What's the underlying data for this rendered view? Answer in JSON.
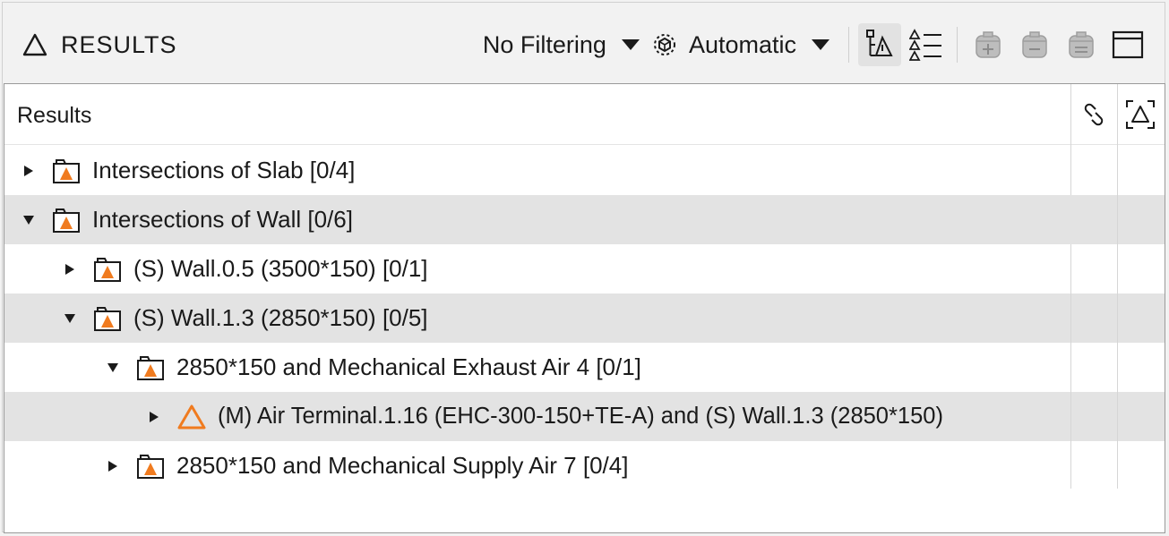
{
  "header": {
    "title": "RESULTS",
    "filter_label": "No Filtering",
    "mode_label": "Automatic"
  },
  "colors": {
    "accent_orange": "#f07b1f",
    "row_shade": "#e3e3e3"
  },
  "tree": {
    "column_title": "Results",
    "rows": [
      {
        "label": "Intersections of Slab [0/4]",
        "expanded": false
      },
      {
        "label": "Intersections of Wall [0/6]",
        "expanded": true
      },
      {
        "label": "(S) Wall.0.5 (3500*150) [0/1]",
        "expanded": false
      },
      {
        "label": "(S) Wall.1.3 (2850*150) [0/5]",
        "expanded": true
      },
      {
        "label": "2850*150 and Mechanical Exhaust Air 4 [0/1]",
        "expanded": true
      },
      {
        "label": "(M) Air Terminal.1.16 (EHC-300-150+TE-A) and (S) Wall.1.3 (2850*150)",
        "expanded": false
      },
      {
        "label": "2850*150 and Mechanical Supply Air 7 [0/4]",
        "expanded": false
      }
    ]
  }
}
